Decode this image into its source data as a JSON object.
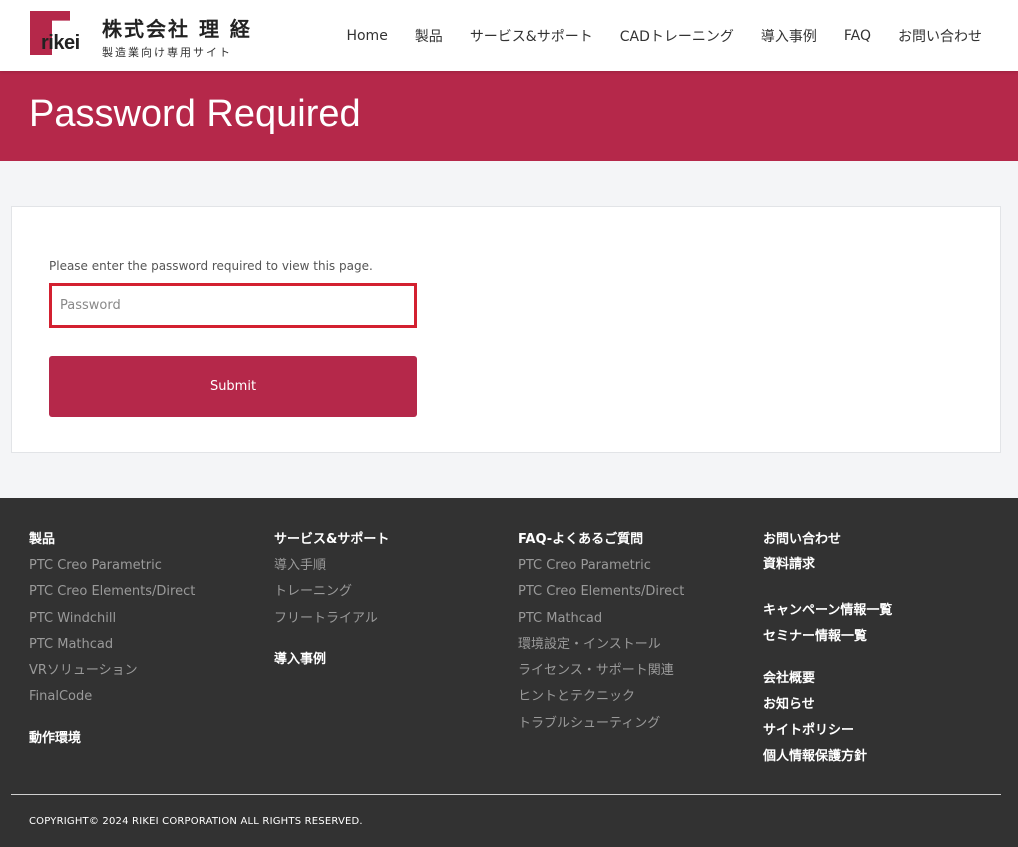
{
  "header": {
    "logo": {
      "wordmark": "rikei",
      "company": "株式会社 理 経",
      "tagline": "製造業向け専用サイト"
    },
    "nav": [
      {
        "label": "Home"
      },
      {
        "label": "製品"
      },
      {
        "label": "サービス&サポート"
      },
      {
        "label": "CADトレーニング"
      },
      {
        "label": "導入事例"
      },
      {
        "label": "FAQ"
      },
      {
        "label": "お問い合わせ"
      }
    ]
  },
  "banner": {
    "title": "Password Required"
  },
  "form": {
    "instruction": "Please enter the password required to view this page.",
    "password_placeholder": "Password",
    "password_value": "",
    "submit_label": "Submit"
  },
  "footer": {
    "col1": {
      "heading": "製品",
      "links": [
        "PTC Creo Parametric",
        "PTC Creo Elements/Direct",
        "PTC Windchill",
        "PTC Mathcad",
        "VRソリューション",
        "FinalCode"
      ],
      "heading2": "動作環境"
    },
    "col2": {
      "heading": "サービス&サポート",
      "links": [
        "導入手順",
        "トレーニング",
        "フリートライアル"
      ],
      "heading2": "導入事例"
    },
    "col3": {
      "heading": "FAQ-よくあるご質問",
      "links": [
        "PTC Creo Parametric",
        "PTC Creo Elements/Direct",
        "PTC Mathcad",
        "環境設定・インストール",
        "ライセンス・サポート関連",
        "ヒントとテクニック",
        "トラブルシューティング"
      ]
    },
    "col4": {
      "heading": "お問い合わせ",
      "group1": [
        "資料請求"
      ],
      "group2": [
        "キャンペーン情報一覧",
        "セミナー情報一覧"
      ],
      "group3": [
        "会社概要",
        "お知らせ",
        "サイトポリシー",
        "個人情報保護方針"
      ]
    },
    "copyright": "COPYRIGHT© 2024 RIKEI CORPORATION ALL RIGHTS RESERVED."
  },
  "colors": {
    "brand": "#b5284a",
    "input_border_focus": "#d32030",
    "footer_bg": "#323232",
    "page_bg": "#f4f5f7"
  }
}
